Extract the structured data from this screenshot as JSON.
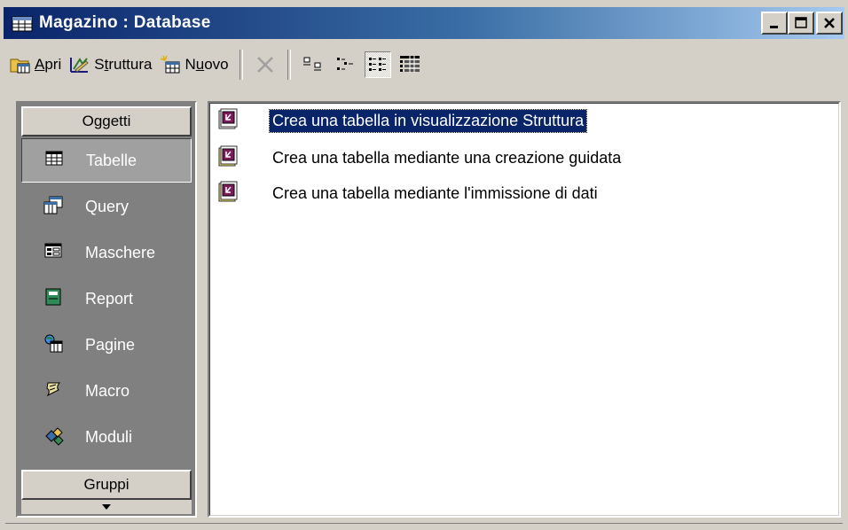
{
  "window": {
    "title": "Magazino : Database",
    "controls": {
      "minimize": "_",
      "maximize": "□",
      "close": "×"
    }
  },
  "toolbar": {
    "open_label_accel": "A",
    "open_label_rest": "pri",
    "design_label_pre": "S",
    "design_label_accel": "t",
    "design_label_rest": "ruttura",
    "new_label_pre": "N",
    "new_label_accel": "u",
    "new_label_rest": "ovo",
    "icons": [
      "open-icon",
      "design-icon",
      "new-icon",
      "delete-icon",
      "large-icons-icon",
      "small-icons-icon",
      "list-view-icon",
      "details-view-icon"
    ]
  },
  "objects_panel": {
    "header": "Oggetti",
    "items": [
      {
        "label": "Tabelle",
        "icon": "table-icon",
        "selected": true
      },
      {
        "label": "Query",
        "icon": "query-icon"
      },
      {
        "label": "Maschere",
        "icon": "form-icon"
      },
      {
        "label": "Report",
        "icon": "report-icon"
      },
      {
        "label": "Pagine",
        "icon": "page-icon"
      },
      {
        "label": "Macro",
        "icon": "macro-icon"
      },
      {
        "label": "Moduli",
        "icon": "module-icon"
      }
    ],
    "groups_label": "Gruppi"
  },
  "list": {
    "items": [
      {
        "label": "Crea una tabella in visualizzazione Struttura",
        "selected": true
      },
      {
        "label": "Crea una tabella mediante una creazione guidata"
      },
      {
        "label": "Crea una tabella mediante l'immissione di dati"
      }
    ]
  },
  "colors": {
    "titlebar_start": "#0a246a",
    "titlebar_end": "#a6caf0",
    "selection": "#0a246a",
    "panel_bg": "#808080",
    "chrome": "#d4d0c8"
  }
}
